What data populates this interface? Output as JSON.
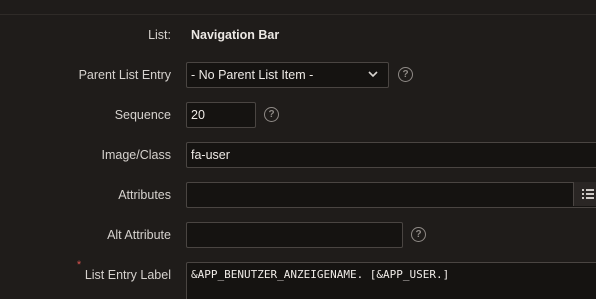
{
  "form": {
    "list": {
      "label": "List:",
      "value": "Navigation Bar"
    },
    "parent_list_entry": {
      "label": "Parent List Entry",
      "selected": "- No Parent List Item -",
      "help": "?"
    },
    "sequence": {
      "label": "Sequence",
      "value": "20",
      "help": "?"
    },
    "image_class": {
      "label": "Image/Class",
      "value": "fa-user"
    },
    "attributes": {
      "label": "Attributes",
      "value": "",
      "button_icon": "list-icon"
    },
    "alt_attribute": {
      "label": "Alt Attribute",
      "value": "",
      "help": "?"
    },
    "list_entry_label": {
      "label": "List Entry Label",
      "required_mark": "*",
      "value": "&APP_BENUTZER_ANZEIGENAME. [&APP_USER.]"
    }
  },
  "colors": {
    "background": "#1f1c1a",
    "field_bg": "#151311",
    "field_border": "#4a4542",
    "required": "#d9534f"
  }
}
